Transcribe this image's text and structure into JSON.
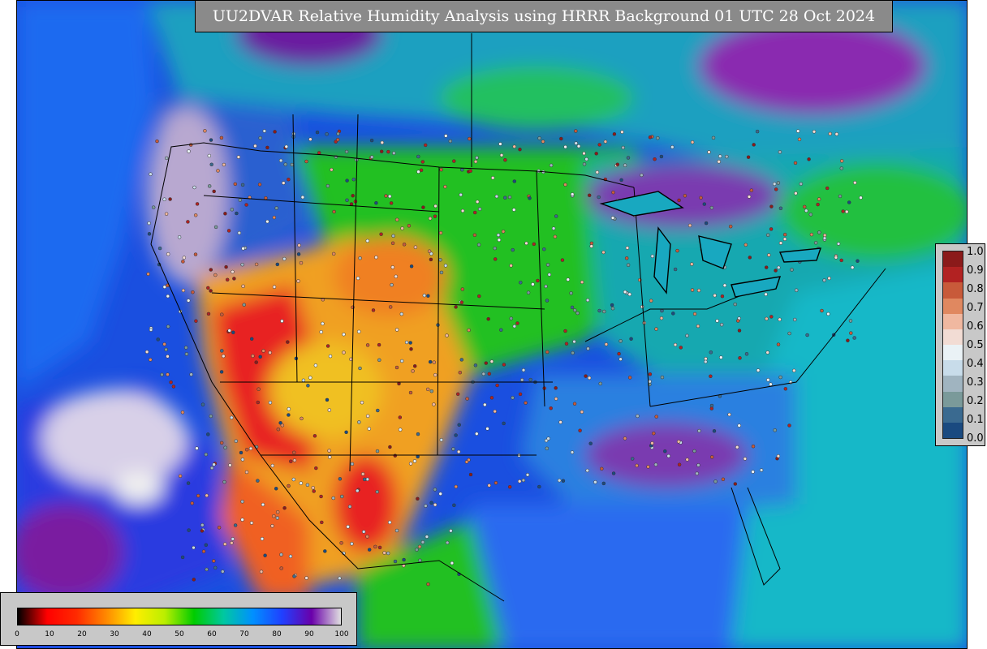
{
  "title": "UU2DVAR Relative Humidity Analysis using HRRR Background 01 UTC 28 Oct 2024",
  "colors": {
    "ocean": "#1a4fe0",
    "very_moist": "#7a1aa0",
    "moist": "#1aa0e0",
    "mid": "#20d020",
    "dry": "#e0e020",
    "very_dry": "#e02020",
    "cloud_white": "#e8e0ec",
    "legend_bg": "#c8c8c8",
    "title_bg": "#8a8a8a"
  },
  "background_colorbar": {
    "ticks": [
      "0",
      "10",
      "20",
      "30",
      "40",
      "50",
      "60",
      "70",
      "80",
      "90",
      "100"
    ],
    "stops": [
      "#000000",
      "#ff0000",
      "#ff2a00",
      "#ff8800",
      "#ffee00",
      "#bbee00",
      "#00cc00",
      "#00c8a0",
      "#0090ff",
      "#2040ff",
      "#6a00aa",
      "#e0e0e0"
    ]
  },
  "observation_colorbar": {
    "ticks": [
      "1.0",
      "0.9",
      "0.8",
      "0.7",
      "0.6",
      "0.5",
      "0.4",
      "0.3",
      "0.2",
      "0.1",
      "0.0"
    ],
    "cells": [
      "#8b1a1a",
      "#b22222",
      "#c85a3a",
      "#e08860",
      "#f0b8a0",
      "#f2dcd4",
      "#eaf2f6",
      "#c8dcea",
      "#a0b4c0",
      "#7a9a9a",
      "#3a6a90",
      "#1a4a80"
    ]
  }
}
